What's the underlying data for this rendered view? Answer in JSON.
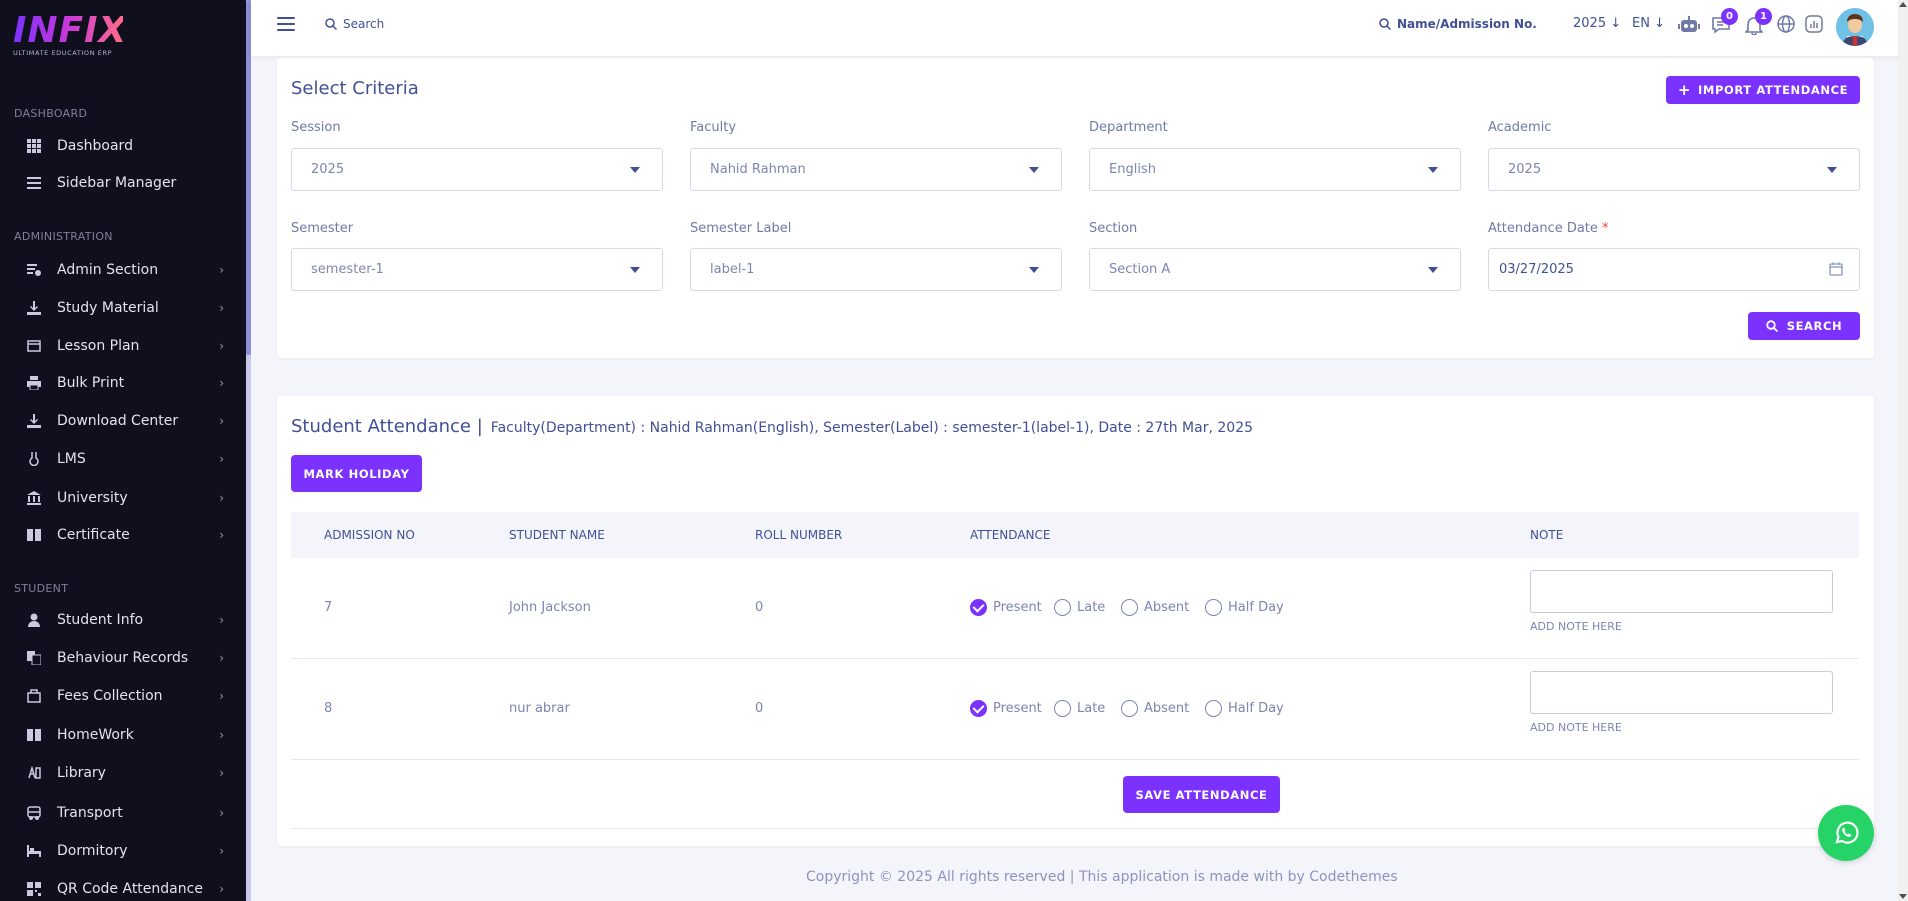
{
  "brand": {
    "logo": "INFIX",
    "tagline": "ULTIMATE EDUCATION ERP"
  },
  "sidebar": {
    "sections": {
      "dashboard": "DASHBOARD",
      "administration": "ADMINISTRATION",
      "student": "STUDENT"
    },
    "dashboard_items": [
      {
        "label": "Dashboard",
        "icon": "grid-icon"
      },
      {
        "label": "Sidebar Manager",
        "icon": "list-icon"
      }
    ],
    "admin_items": [
      {
        "label": "Admin Section",
        "icon": "admin-icon"
      },
      {
        "label": "Study Material",
        "icon": "download-icon"
      },
      {
        "label": "Lesson Plan",
        "icon": "lesson-icon"
      },
      {
        "label": "Bulk Print",
        "icon": "print-icon"
      },
      {
        "label": "Download Center",
        "icon": "download-icon"
      },
      {
        "label": "LMS",
        "icon": "lms-icon"
      },
      {
        "label": "University",
        "icon": "university-icon"
      },
      {
        "label": "Certificate",
        "icon": "book-icon"
      }
    ],
    "student_items": [
      {
        "label": "Student Info",
        "icon": "user-icon"
      },
      {
        "label": "Behaviour Records",
        "icon": "records-icon"
      },
      {
        "label": "Fees Collection",
        "icon": "fees-icon"
      },
      {
        "label": "HomeWork",
        "icon": "book-icon"
      },
      {
        "label": "Library",
        "icon": "library-icon"
      },
      {
        "label": "Transport",
        "icon": "bus-icon"
      },
      {
        "label": "Dormitory",
        "icon": "bed-icon"
      },
      {
        "label": "QR Code Attendance",
        "icon": "qr-icon"
      }
    ]
  },
  "header": {
    "search_label": "Search",
    "student_search_label": "Name/Admission No.",
    "year": "2025",
    "language": "EN",
    "chat_badge": "0",
    "notification_badge": "1"
  },
  "criteria": {
    "title": "Select Criteria",
    "import_button": "IMPORT ATTENDANCE",
    "search_button": "SEARCH",
    "fields": {
      "session": {
        "label": "Session",
        "value": "2025"
      },
      "faculty": {
        "label": "Faculty",
        "value": "Nahid Rahman"
      },
      "department": {
        "label": "Department",
        "value": "English"
      },
      "academic": {
        "label": "Academic",
        "value": "2025"
      },
      "semester": {
        "label": "Semester",
        "value": "semester-1"
      },
      "semester_label": {
        "label": "Semester Label",
        "value": "label-1"
      },
      "section": {
        "label": "Section",
        "value": "Section A"
      },
      "attendance_date": {
        "label": "Attendance Date",
        "required": "*",
        "value": "03/27/2025"
      }
    }
  },
  "attendance": {
    "title": "Student Attendance |",
    "subtitle": "Faculty(Department) : Nahid Rahman(English), Semester(Label) : semester-1(label-1), Date : 27th Mar, 2025",
    "mark_holiday_button": "MARK HOLIDAY",
    "columns": [
      "ADMISSION NO",
      "STUDENT NAME",
      "ROLL NUMBER",
      "ATTENDANCE",
      "NOTE"
    ],
    "options": [
      "Present",
      "Late",
      "Absent",
      "Half Day"
    ],
    "note_hint": "ADD NOTE HERE",
    "rows": [
      {
        "admission_no": "7",
        "name": "John Jackson",
        "roll": "0",
        "selected": "Present"
      },
      {
        "admission_no": "8",
        "name": "nur abrar",
        "roll": "0",
        "selected": "Present"
      }
    ],
    "save_button": "SAVE ATTENDANCE"
  },
  "footer": {
    "text": "Copyright © 2025 All rights reserved | This application is made with by Codethemes"
  },
  "colors": {
    "accent": "#7c32ff",
    "sidebar_bg": "#0f0f1e",
    "text": "#415094",
    "whatsapp": "#25d366"
  }
}
